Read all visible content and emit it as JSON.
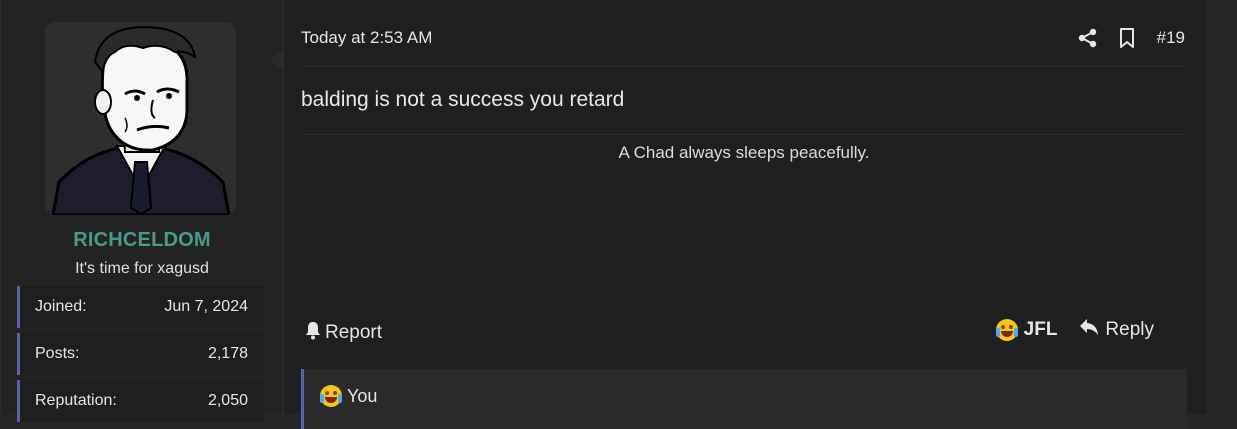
{
  "user": {
    "name": "RICHCELDOM",
    "title": "It's time for xagusd",
    "stats": [
      {
        "label": "Joined:",
        "value": "Jun 7, 2024"
      },
      {
        "label": "Posts:",
        "value": "2,178"
      },
      {
        "label": "Reputation:",
        "value": "2,050"
      }
    ]
  },
  "post": {
    "date": "Today at 2:53 AM",
    "number": "#19",
    "message": "balding is not a success you retard",
    "signature": "A Chad always sleeps peacefully."
  },
  "actions": {
    "report": "Report",
    "jfl": "JFL",
    "reply": "Reply"
  },
  "reactions": {
    "label": "You"
  },
  "colors": {
    "username": "#4a9a8b",
    "accent_bar": "#5d5fb3",
    "background": "#1f1f1f"
  },
  "icons": [
    "share-icon",
    "bookmark-icon",
    "bell-icon",
    "reply-icon",
    "crying-laughing-emoji"
  ]
}
